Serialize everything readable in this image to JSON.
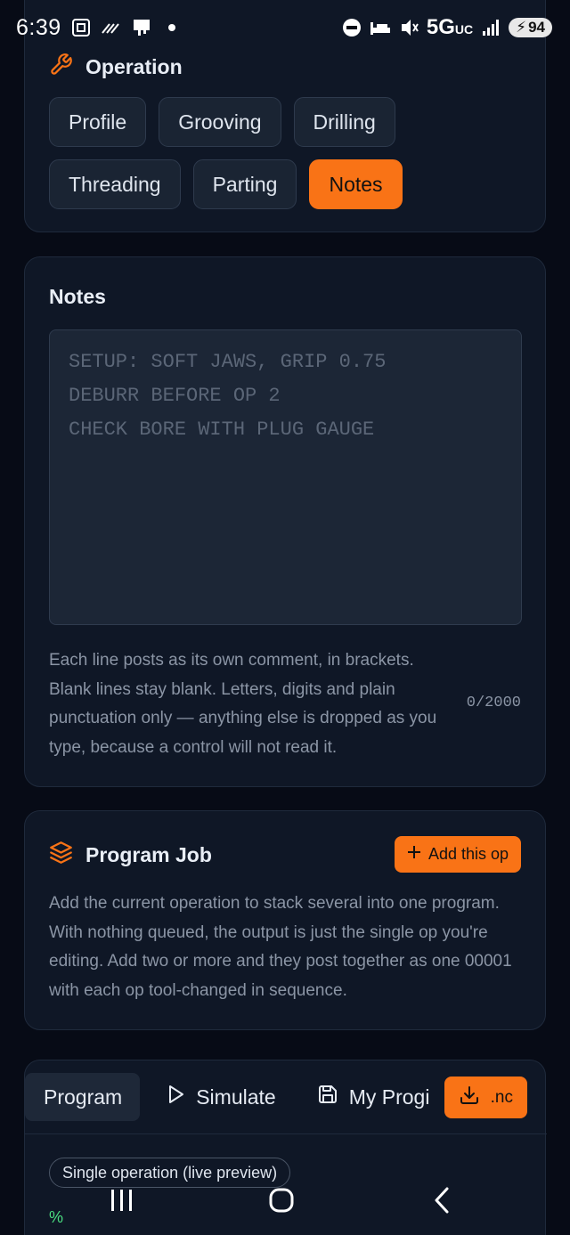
{
  "status_bar": {
    "time": "6:39",
    "network": "5G",
    "network_suffix": "UC",
    "battery": "94"
  },
  "operation": {
    "title": "Operation",
    "buttons": [
      {
        "label": "Profile",
        "active": false
      },
      {
        "label": "Grooving",
        "active": false
      },
      {
        "label": "Drilling",
        "active": false
      },
      {
        "label": "Threading",
        "active": false
      },
      {
        "label": "Parting",
        "active": false
      },
      {
        "label": "Notes",
        "active": true
      }
    ]
  },
  "notes": {
    "title": "Notes",
    "placeholder": "SETUP: SOFT JAWS, GRIP 0.75\nDEBURR BEFORE OP 2\nCHECK BORE WITH PLUG GAUGE",
    "help": "Each line posts as its own comment, in brackets. Blank lines stay blank. Letters, digits and plain punctuation only — anything else is dropped as you type, because a control will not read it.",
    "counter": "0/2000"
  },
  "program_job": {
    "title": "Program Job",
    "add_button": "Add this op",
    "description": "Add the current operation to stack several into one program. With nothing queued, the output is just the single op you're editing. Add two or more and they post together as one 00001 with each op tool-changed in sequence."
  },
  "program_panel": {
    "tabs": [
      {
        "label": "Program",
        "active": true
      },
      {
        "label": "Simulate",
        "icon": "play-icon"
      },
      {
        "label": "My Progi",
        "icon": "save-icon"
      }
    ],
    "export_button": ".nc",
    "mode_chip": "Single operation (live preview)",
    "percent": "%"
  },
  "colors": {
    "accent": "#f97316",
    "background": "#070b16",
    "card": "#0f1726"
  }
}
